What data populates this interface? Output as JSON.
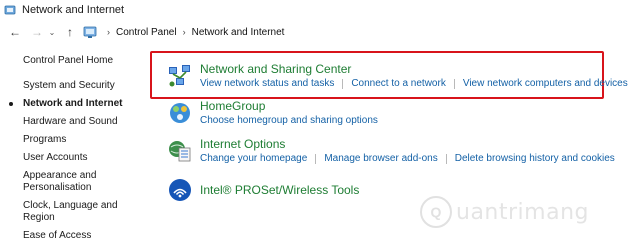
{
  "window": {
    "title": "Network and Internet"
  },
  "addressbar": {
    "crumbs": [
      "Control Panel",
      "Network and Internet"
    ],
    "separator": "›"
  },
  "sidebar": {
    "home": "Control Panel Home",
    "items": [
      {
        "label": "System and Security",
        "active": false
      },
      {
        "label": "Network and Internet",
        "active": true
      },
      {
        "label": "Hardware and Sound",
        "active": false
      },
      {
        "label": "Programs",
        "active": false
      },
      {
        "label": "User Accounts",
        "active": false
      },
      {
        "label": "Appearance and",
        "active": false
      },
      {
        "label": "Personalisation",
        "active": false
      },
      {
        "label": "Clock, Language and Region",
        "active": false
      },
      {
        "label": "Ease of Access",
        "active": false
      }
    ]
  },
  "main": {
    "sections": [
      {
        "title": "Network and Sharing Center",
        "links": [
          "View network status and tasks",
          "Connect to a network",
          "View network computers and devices"
        ]
      },
      {
        "title": "HomeGroup",
        "links": [
          "Choose homegroup and sharing options"
        ]
      },
      {
        "title": "Internet Options",
        "links": [
          "Change your homepage",
          "Manage browser add-ons",
          "Delete browsing history and cookies"
        ]
      },
      {
        "title": "Intel® PROSet/Wireless Tools",
        "links": []
      }
    ]
  },
  "highlight": {
    "color": "#d8141b"
  },
  "watermark": {
    "text": "uantrimang"
  },
  "colors": {
    "section_title": "#1e7d33",
    "link": "#1461a6"
  }
}
